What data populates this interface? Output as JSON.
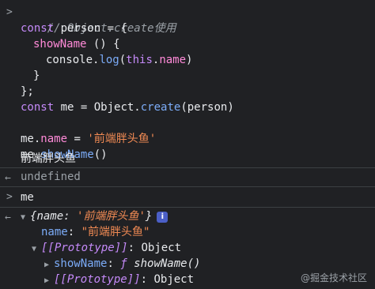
{
  "input_prompt": ">",
  "code": {
    "comment": "// Object.create使用",
    "l2_kw": "const",
    "l2_name": " person = {",
    "l3_prop": "showName",
    "l3_rest": " () {",
    "l4_a": "console.",
    "l4_fn": "log",
    "l4_b": "(",
    "l4_this": "this",
    "l4_dot": ".",
    "l4_prop": "name",
    "l4_c": ")",
    "l5": "}",
    "l6": "};",
    "l7_kw": "const",
    "l7_a": " me = Object.",
    "l7_fn": "create",
    "l7_b": "(person)",
    "l9_a": "me.",
    "l9_prop": "name",
    "l9_b": " = ",
    "l9_str": "'前端胖头鱼'",
    "l10_a": "me.",
    "l10_fn": "showName",
    "l10_b": "()"
  },
  "log_output": "前端胖头鱼",
  "return_icon": "←",
  "return_value": "undefined",
  "second_input": "me",
  "object_tree": {
    "summary_open": "{",
    "summary_key": "name",
    "summary_sep": ": ",
    "summary_val": "'前端胖头鱼'",
    "summary_close": "}",
    "info": "i",
    "name_key": "name",
    "name_sep": ": ",
    "name_val": "\"前端胖头鱼\"",
    "proto_key": "[[Prototype]]",
    "proto_sep": ": ",
    "proto_val": "Object",
    "showname_key": "showName",
    "showname_sep": ": ",
    "showname_f": "ƒ",
    "showname_val": " showName()",
    "proto2_key": "[[Prototype]]",
    "proto2_sep": ": ",
    "proto2_val": "Object"
  },
  "watermark": "@掘金技术社区",
  "colors": {
    "background": "#202124",
    "keyword": "#c58af9",
    "property": "#ff8ad8",
    "function": "#7cacf8",
    "string": "#f28b54"
  }
}
